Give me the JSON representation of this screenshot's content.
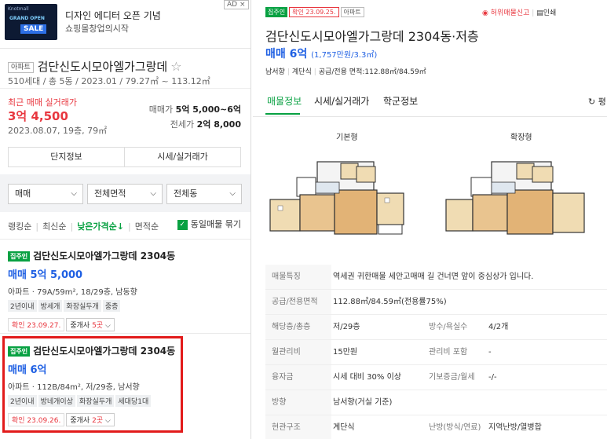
{
  "ad": {
    "thumb_small": "Knotmall",
    "thumb_line": "GRAND OPEN",
    "thumb_big": "SALE",
    "title": "디자인 에디터 오픈 기념",
    "subtitle": "쇼핑몰창업의시작",
    "badge": "AD ×"
  },
  "complex": {
    "type_tag": "아파트",
    "name": "검단신도시모아엘가그랑데",
    "star": "☆",
    "meta": "510세대 / 총 5동 / 2023.01 / 79.27㎡ ~ 113.12㎡"
  },
  "recent": {
    "label": "최근 매매 실거래가",
    "price": "3억 4,500",
    "date": "2023.08.07, 19층, 79㎡",
    "sale_label": "매매가",
    "sale_value": "5억 5,000~6억",
    "jeonse_label": "전세가",
    "jeonse_value": "2억 8,000"
  },
  "buttons": {
    "complex_info": "단지정보",
    "market_price": "시세/실거래가"
  },
  "filters": {
    "deal": "매매",
    "area": "전체면적",
    "dong": "전체동"
  },
  "sort": {
    "ranking": "랭킹순",
    "latest": "최신순",
    "low_price": "낮은가격순↓",
    "area": "면적순",
    "same_listing": "동일매물 묶기"
  },
  "listings": [
    {
      "tag": "집주인",
      "title": "검단신도시모아엘가그랑데 2304동",
      "price": "매매 5억 5,000",
      "spec": "아파트 · 79A/59m², 18/29층, 남동향",
      "chips": [
        "2년이내",
        "방세개",
        "화장실두개",
        "중층"
      ],
      "confirm": "확인 23.09.27.",
      "agent_prefix": "중개사 ",
      "agent_count": "5곳",
      "agent_suffix": " ⌵"
    },
    {
      "tag": "집주인",
      "title": "검단신도시모아엘가그랑데 2304동",
      "price": "매매 6억",
      "spec": "아파트 · 112B/84m², 저/29층, 남서향",
      "chips": [
        "2년이내",
        "방네개이상",
        "화장실두개",
        "세대당1대"
      ],
      "confirm": "확인 23.09.26.",
      "agent_prefix": "중개사 ",
      "agent_count": "2곳",
      "agent_suffix": " ⌵"
    }
  ],
  "detail": {
    "owner_tag": "집주인",
    "confirm_tag": "확인 23.09.25.",
    "apt_tag": "아파트",
    "report": "허위매물신고",
    "print": "인쇄",
    "title": "검단신도시모아엘가그랑데 2304동·저층",
    "price": "매매 6억",
    "price_per": "(1,757만원/3.3㎡)",
    "meta1": "남서향",
    "meta2": "계단식",
    "meta3": "공급/전용 면적:112.88㎡/84.59㎡"
  },
  "tabs": {
    "listing_info": "매물정보",
    "market": "시세/실거래가",
    "school": "학군정보",
    "reload": "↻ 평"
  },
  "plans": {
    "basic": "기본형",
    "extended": "확장형"
  },
  "table": {
    "rows": [
      {
        "h": "매물특징",
        "v": "역세권 귀한매물 세안고매매 길 건너면 앞이 중심상가 입니다."
      },
      {
        "h": "공급/전용면적",
        "v": "112.88㎡/84.59㎡(전용률75%)"
      },
      {
        "h": "해당층/총층",
        "v": "저/29층",
        "h2": "방수/욕실수",
        "v2": "4/2개"
      },
      {
        "h": "월관리비",
        "v": "15만원",
        "h2": "관리비 포함",
        "v2": "-"
      },
      {
        "h": "융자금",
        "v": "시세 대비 30% 이상",
        "h2": "기보증금/월세",
        "v2": "-/-"
      },
      {
        "h": "방향",
        "v": "남서향(거실 기준)"
      },
      {
        "h": "현관구조",
        "v": "계단식",
        "h2": "난방(방식/연료)",
        "v2": "지역난방/열병합"
      }
    ]
  }
}
